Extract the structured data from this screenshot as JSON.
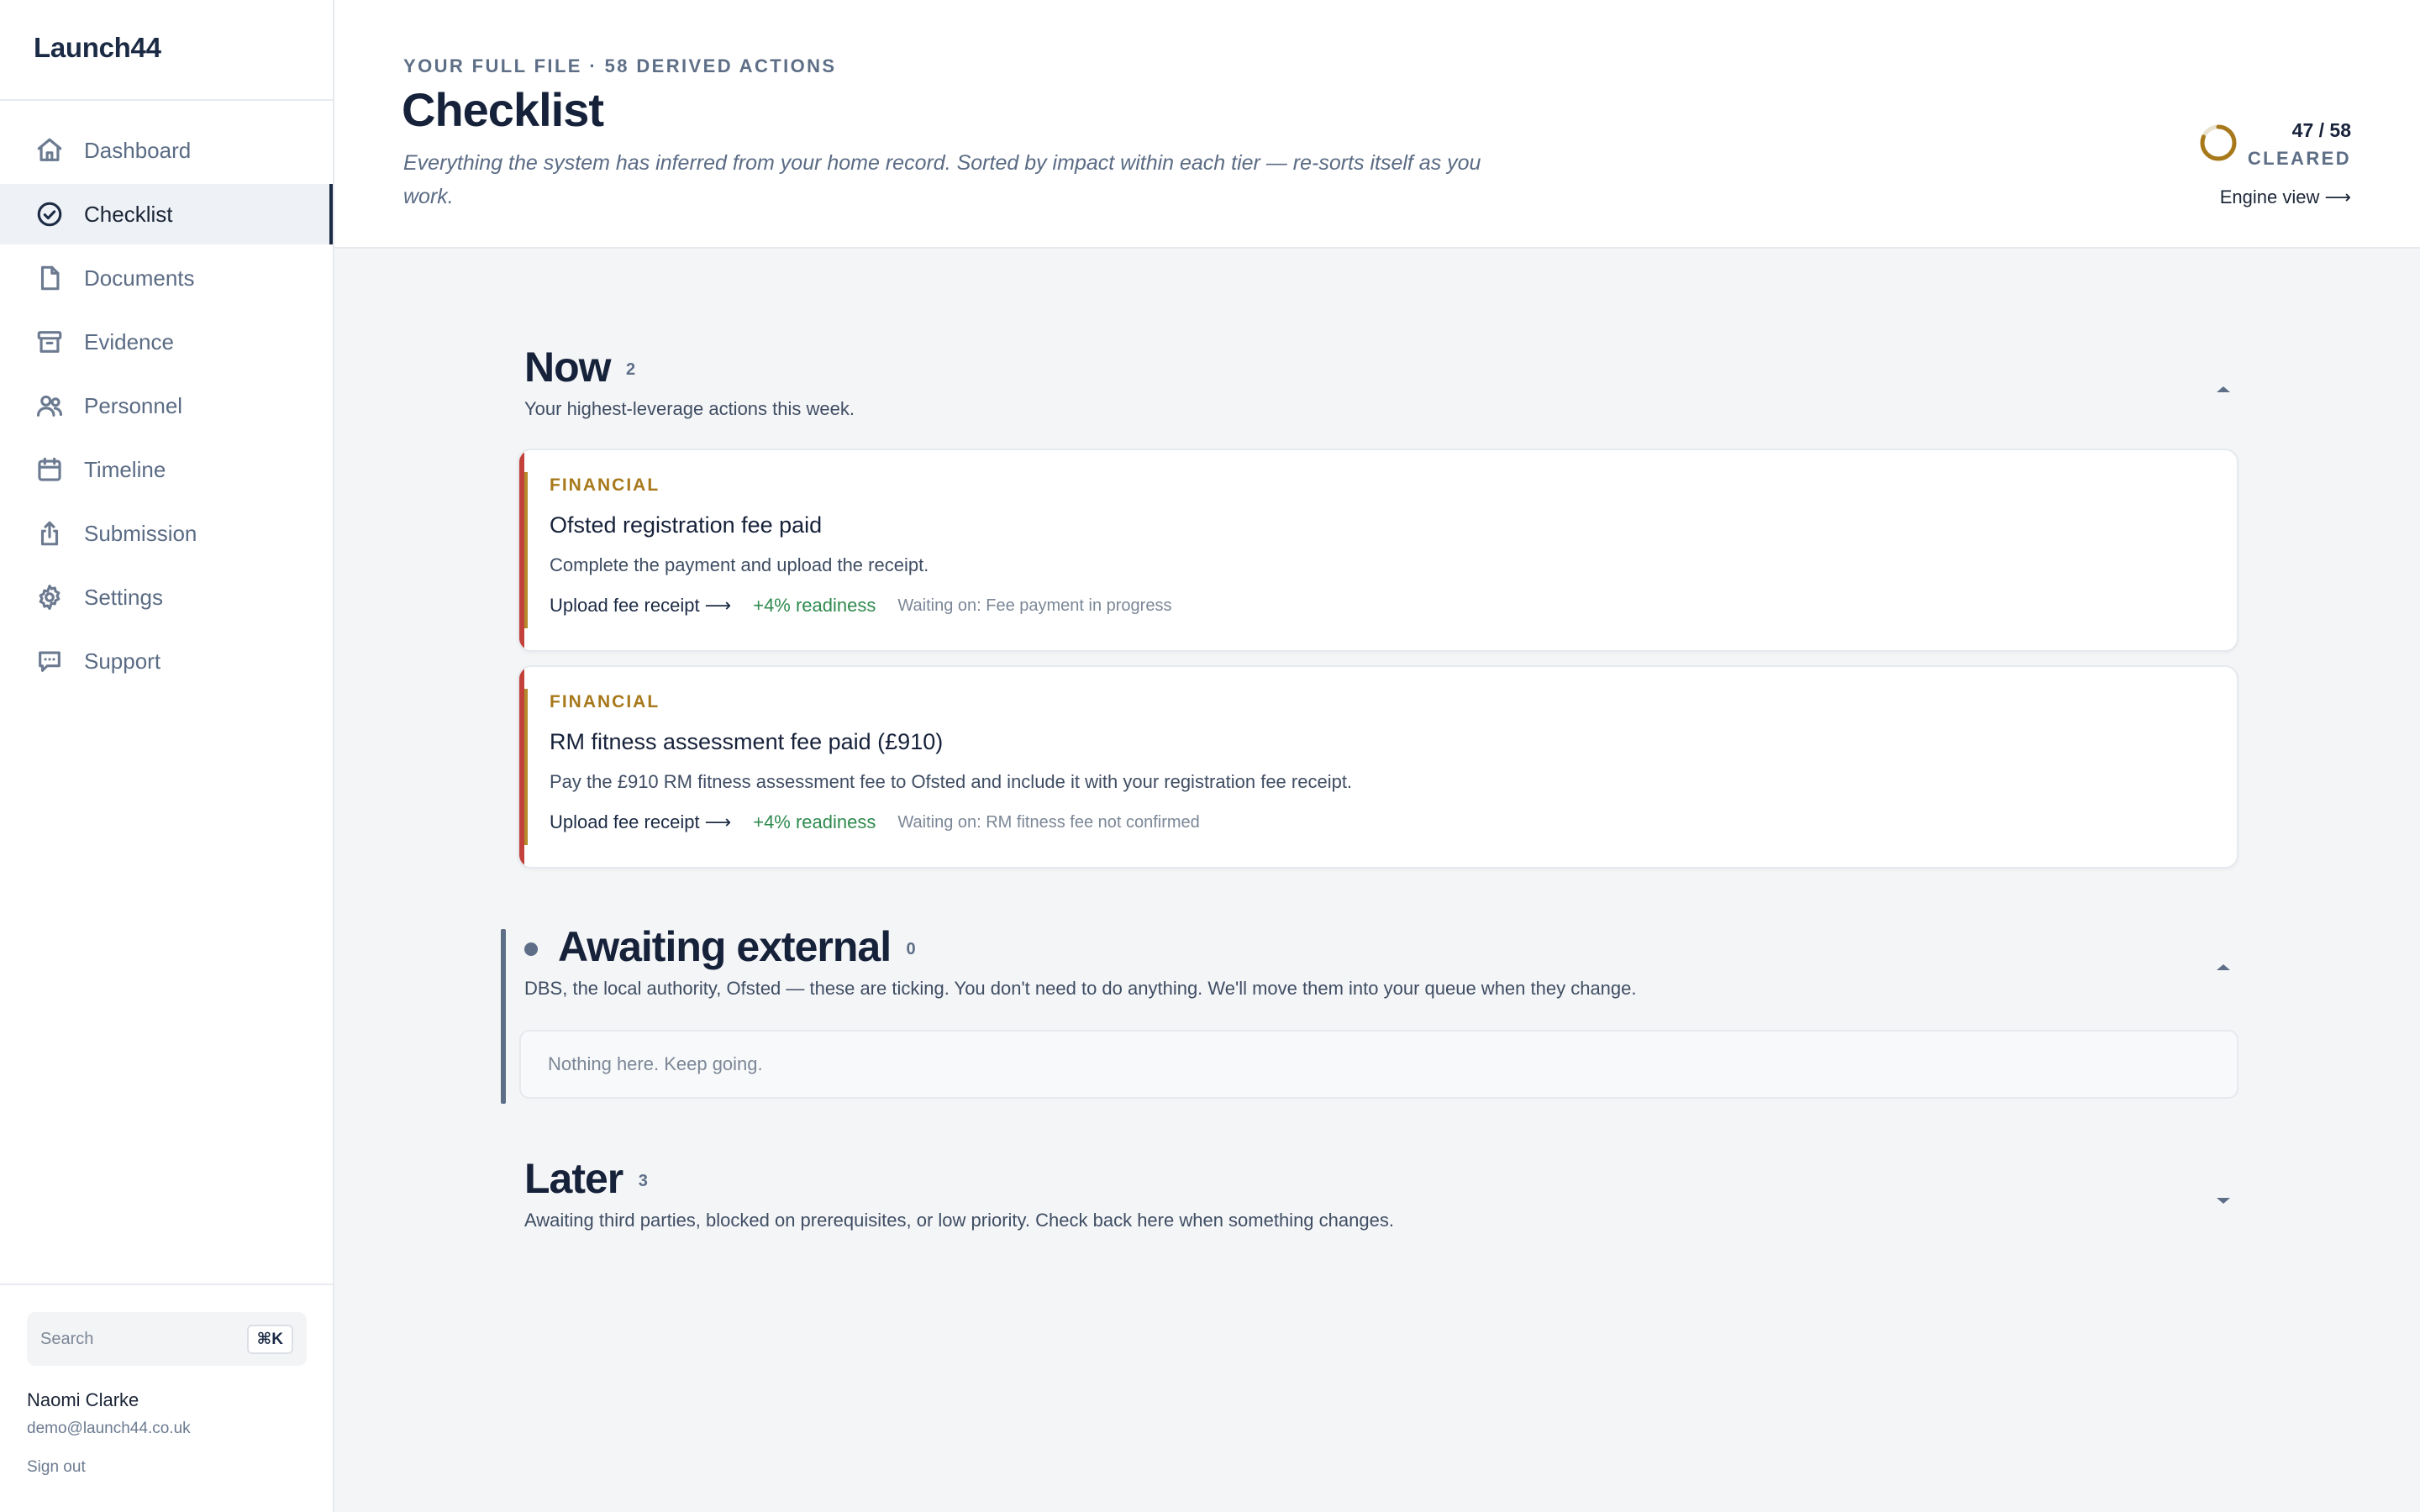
{
  "app": {
    "name": "Launch44"
  },
  "sidebar": {
    "items": [
      {
        "label": "Dashboard",
        "icon": "home-icon"
      },
      {
        "label": "Checklist",
        "icon": "check-circle-icon",
        "active": true
      },
      {
        "label": "Documents",
        "icon": "document-icon"
      },
      {
        "label": "Evidence",
        "icon": "archive-icon"
      },
      {
        "label": "Personnel",
        "icon": "users-icon"
      },
      {
        "label": "Timeline",
        "icon": "calendar-icon"
      },
      {
        "label": "Submission",
        "icon": "share-icon"
      },
      {
        "label": "Settings",
        "icon": "gear-icon"
      },
      {
        "label": "Support",
        "icon": "chat-icon"
      }
    ],
    "search": {
      "placeholder": "Search",
      "shortcut": "⌘K"
    },
    "user": {
      "name": "Naomi Clarke",
      "email": "demo@launch44.co.uk",
      "sign_out": "Sign out"
    }
  },
  "header": {
    "eyebrow": "YOUR FULL FILE · 58 DERIVED ACTIONS",
    "title": "Checklist",
    "description": "Everything the system has inferred from your home record. Sorted by impact within each tier — re-sorts itself as you work.",
    "progress": {
      "count": "47 / 58",
      "label": "CLEARED",
      "fraction": 0.81
    },
    "engine_link": "Engine view ⟶"
  },
  "sections": {
    "now": {
      "title": "Now",
      "count": "2",
      "description": "Your highest-leverage actions this week.",
      "cards": [
        {
          "tag": "FINANCIAL",
          "title": "Ofsted registration fee paid",
          "description": "Complete the payment and upload the receipt.",
          "action": "Upload fee receipt ⟶",
          "gain": "+4% readiness",
          "waiting": "Waiting on: Fee payment in progress"
        },
        {
          "tag": "FINANCIAL",
          "title": "RM fitness assessment fee paid (£910)",
          "description": "Pay the £910 RM fitness assessment fee to Ofsted and include it with your registration fee receipt.",
          "action": "Upload fee receipt ⟶",
          "gain": "+4% readiness",
          "waiting": "Waiting on: RM fitness fee not confirmed"
        }
      ]
    },
    "awaiting": {
      "title": "Awaiting external",
      "count": "0",
      "description": "DBS, the local authority, Ofsted — these are ticking. You don't need to do anything. We'll move them into your queue when they change.",
      "empty_text": "Nothing here. Keep going."
    },
    "later": {
      "title": "Later",
      "count": "3",
      "description": "Awaiting third parties, blocked on prerequisites, or low priority. Check back here when something changes."
    }
  },
  "colors": {
    "brand": "#1c2b45",
    "financial_tag": "#a7791b",
    "urgent_stripe": "#c2423b",
    "readiness_gain": "#2f8a4d",
    "progress_ring": "#a7791b"
  }
}
